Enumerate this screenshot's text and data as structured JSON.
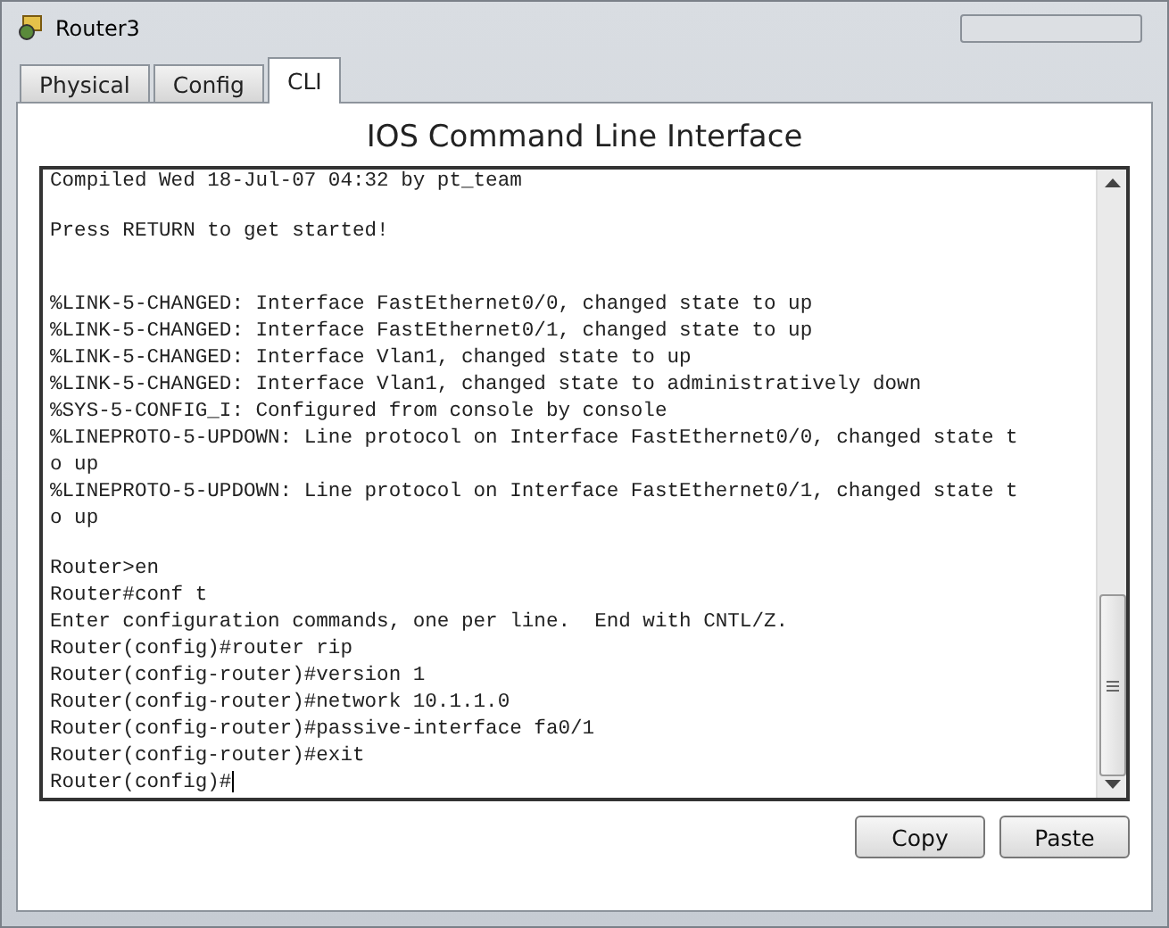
{
  "window": {
    "title": "Router3"
  },
  "tabs": [
    {
      "label": "Physical",
      "selected": false
    },
    {
      "label": "Config",
      "selected": false
    },
    {
      "label": "CLI",
      "selected": true
    }
  ],
  "heading": "IOS Command Line Interface",
  "terminal": {
    "lines": [
      {
        "kind": "text",
        "text": "Compiled Wed 18-Jul-07 04:32 by pt_team"
      },
      {
        "kind": "blank"
      },
      {
        "kind": "text",
        "text": "Press RETURN to get started!"
      },
      {
        "kind": "blank"
      },
      {
        "kind": "blank"
      },
      {
        "kind": "text",
        "text": "%LINK-5-CHANGED: Interface FastEthernet0/0, changed state to up"
      },
      {
        "kind": "text",
        "text": "%LINK-5-CHANGED: Interface FastEthernet0/1, changed state to up"
      },
      {
        "kind": "text",
        "text": "%LINK-5-CHANGED: Interface Vlan1, changed state to up"
      },
      {
        "kind": "text",
        "text": "%LINK-5-CHANGED: Interface Vlan1, changed state to administratively down"
      },
      {
        "kind": "text",
        "text": "%SYS-5-CONFIG_I: Configured from console by console"
      },
      {
        "kind": "text",
        "text": "%LINEPROTO-5-UPDOWN: Line protocol on Interface FastEthernet0/0, changed state t"
      },
      {
        "kind": "text",
        "text": "o up"
      },
      {
        "kind": "text",
        "text": "%LINEPROTO-5-UPDOWN: Line protocol on Interface FastEthernet0/1, changed state t"
      },
      {
        "kind": "text",
        "text": "o up"
      },
      {
        "kind": "blank"
      },
      {
        "kind": "text",
        "text": "Router>en"
      },
      {
        "kind": "text",
        "text": "Router#conf t"
      },
      {
        "kind": "text",
        "text": "Enter configuration commands, one per line.  End with CNTL/Z."
      },
      {
        "kind": "text",
        "text": "Router(config)#router rip"
      },
      {
        "kind": "text",
        "text": "Router(config-router)#version 1"
      },
      {
        "kind": "text",
        "text": "Router(config-router)#network 10.1.1.0"
      },
      {
        "kind": "text",
        "text": "Router(config-router)#passive-interface fa0/1"
      },
      {
        "kind": "text",
        "text": "Router(config-router)#exit"
      },
      {
        "kind": "prompt",
        "text": "Router(config)#"
      }
    ]
  },
  "buttons": [
    "Copy",
    "Paste"
  ]
}
